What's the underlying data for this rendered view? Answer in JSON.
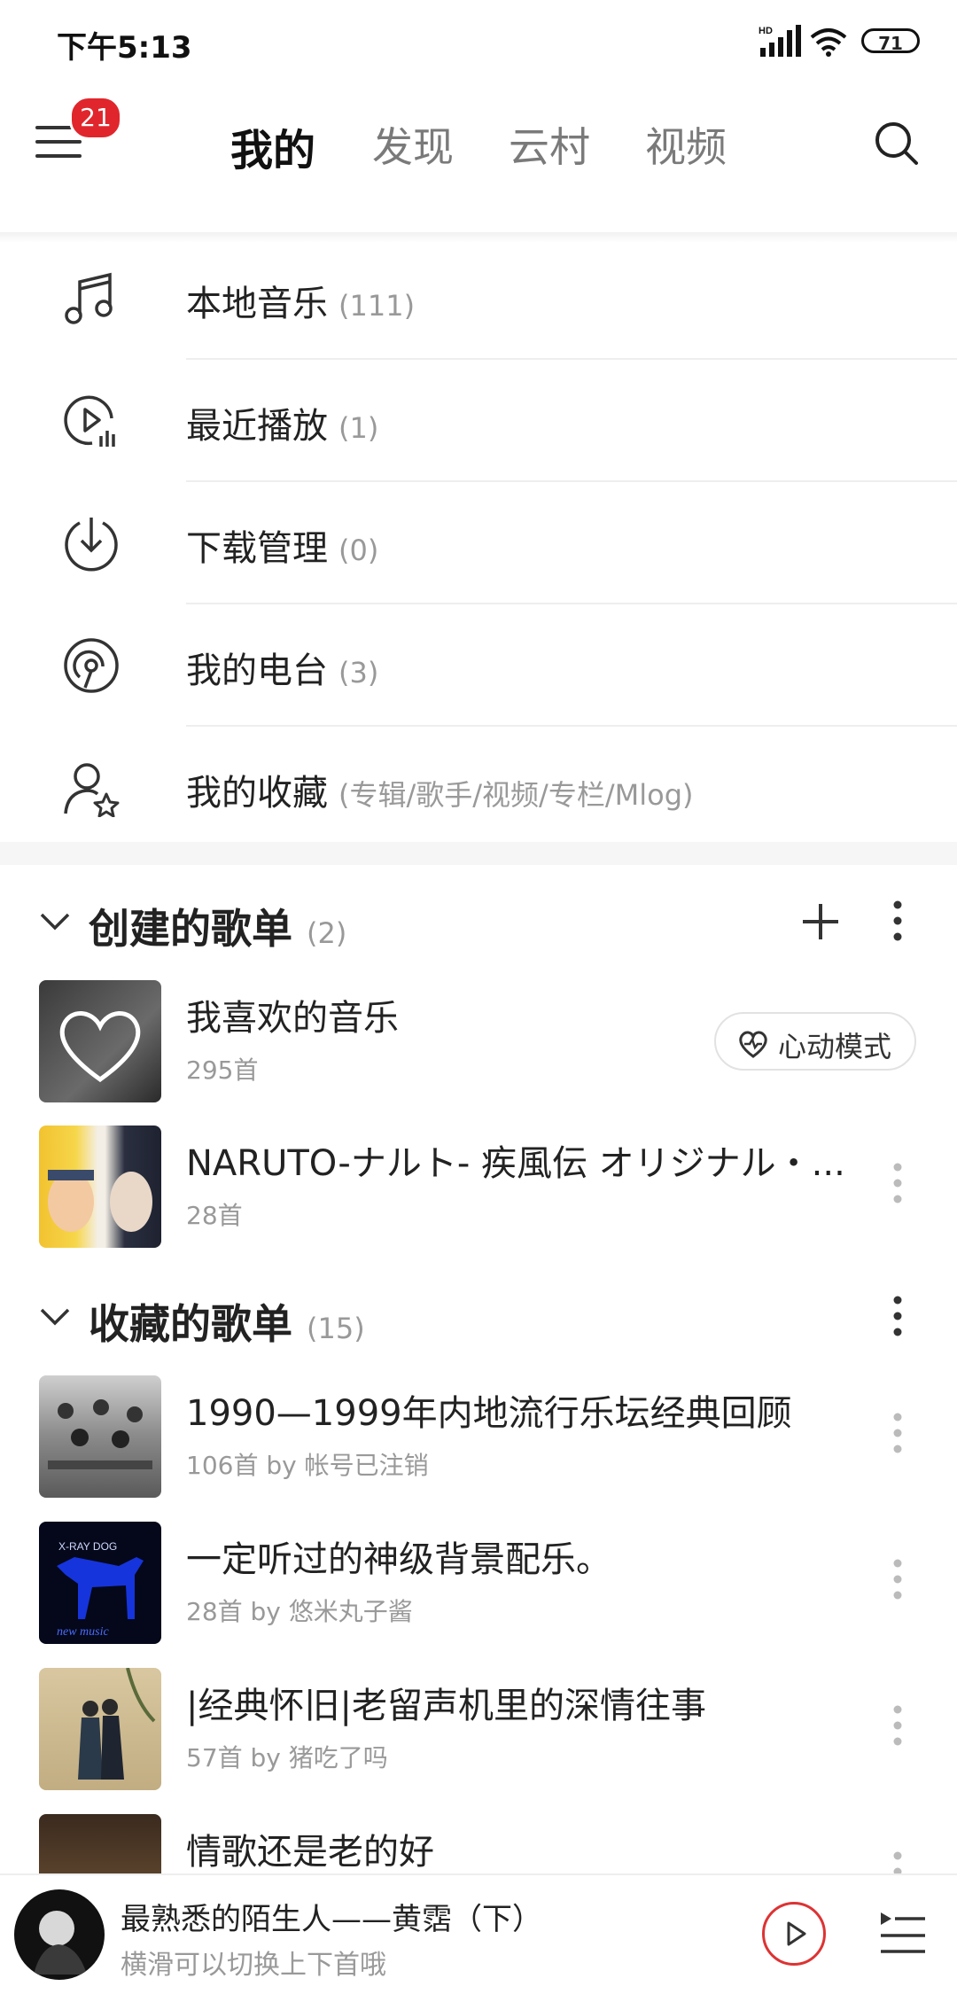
{
  "status": {
    "time": "下午5:13",
    "battery": "71"
  },
  "header": {
    "badge": "21",
    "tabs": [
      {
        "label": "我的"
      },
      {
        "label": "发现"
      },
      {
        "label": "云村"
      },
      {
        "label": "视频"
      }
    ]
  },
  "menu": [
    {
      "label": "本地音乐",
      "count": "(111)",
      "icon": "music-note-icon"
    },
    {
      "label": "最近播放",
      "count": "(1)",
      "icon": "recent-play-icon"
    },
    {
      "label": "下载管理",
      "count": "(0)",
      "icon": "download-icon"
    },
    {
      "label": "我的电台",
      "count": "(3)",
      "icon": "radio-icon"
    },
    {
      "label": "我的收藏",
      "count": "(专辑/歌手/视频/专栏/Mlog)",
      "icon": "user-star-icon"
    }
  ],
  "created": {
    "title": "创建的歌单",
    "count": "(2)",
    "playlists": [
      {
        "name": "我喜欢的音乐",
        "sub": "295首"
      },
      {
        "name": "NARUTO-ナルト- 疾風伝 オリジナル・...",
        "sub": "28首"
      }
    ],
    "heart_mode": "心动模式"
  },
  "collected": {
    "title": "收藏的歌单",
    "count": "(15)",
    "playlists": [
      {
        "name": "1990—1999年内地流行乐坛经典回顾",
        "sub": "106首 by 帐号已注销"
      },
      {
        "name": "一定听过的神级背景配乐。",
        "sub": "28首 by 悠米丸子酱"
      },
      {
        "name": "|经典怀旧|老留声机里的深情往事",
        "sub": "57首 by 猪吃了吗"
      },
      {
        "name": "情歌还是老的好",
        "sub": ""
      }
    ]
  },
  "player": {
    "song": "最熟悉的陌生人——黄霑（下）",
    "hint": "横滑可以切换上下首哦"
  },
  "colors": {
    "accent": "#e0262c"
  }
}
